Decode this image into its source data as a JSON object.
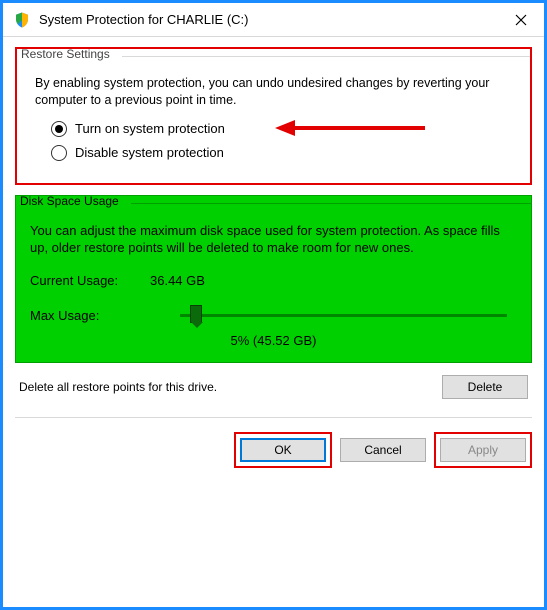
{
  "titlebar": {
    "title": "System Protection for CHARLIE (C:)"
  },
  "restore": {
    "group_label": "Restore Settings",
    "description": "By enabling system protection, you can undo undesired changes by reverting your computer to a previous point in time.",
    "option_on": "Turn on system protection",
    "option_off": "Disable system protection",
    "selected": "on"
  },
  "disk": {
    "group_label": "Disk Space Usage",
    "description": "You can adjust the maximum disk space used for system protection. As space fills up, older restore points will be deleted to make room for new ones.",
    "current_label": "Current Usage:",
    "current_value": "36.44 GB",
    "max_label": "Max Usage:",
    "slider_text": "5% (45.52 GB)",
    "slider_percent": 5
  },
  "delete": {
    "text": "Delete all restore points for this drive.",
    "button": "Delete"
  },
  "footer": {
    "ok": "OK",
    "cancel": "Cancel",
    "apply": "Apply"
  }
}
